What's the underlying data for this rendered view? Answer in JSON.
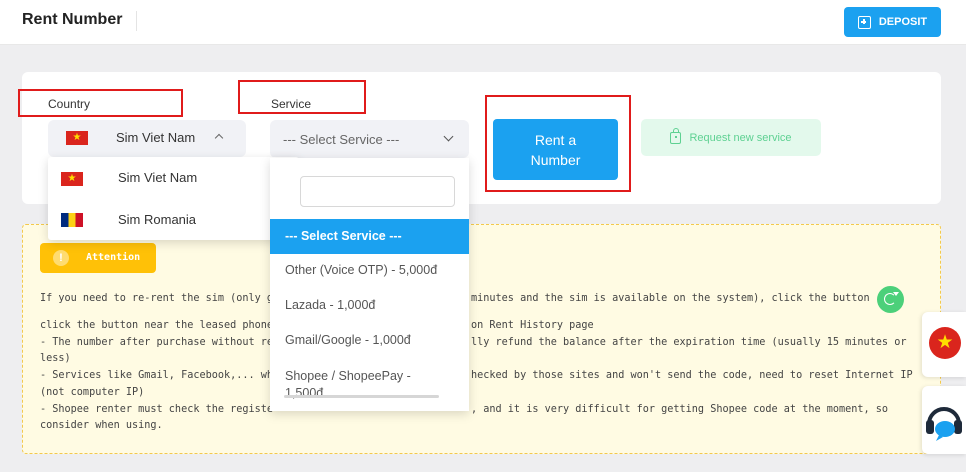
{
  "header": {
    "title": "Rent Number",
    "deposit_label": "DEPOSIT"
  },
  "form": {
    "country_label": "Country",
    "service_label": "Service",
    "country_selected": "Sim Viet Nam",
    "service_selected": "--- Select Service ---",
    "rent_button": "Rent a Number",
    "request_button": "Request new service"
  },
  "country_dropdown": {
    "options": [
      {
        "label": "Sim Viet Nam",
        "flag": "vietnam-flag-icon"
      },
      {
        "label": "Sim Romania",
        "flag": "romania-flag-icon"
      }
    ]
  },
  "service_dropdown": {
    "search_value": "",
    "options": [
      "--- Select Service ---",
      "Other (Voice OTP) - 5,000đ",
      "Lazada - 1,000đ",
      "Gmail/Google - 1,000đ",
      "Shopee / ShopeePay - 1,500đ"
    ]
  },
  "attention": {
    "badge": "Attention",
    "line1_left": "If you need to re-rent the sim (only g",
    "line1_right": "minutes and the sim is available on the system), click the button",
    "line2_left": "click the button near the leased phone",
    "line2_right": "on Rent History page",
    "line3_left": "- The number after purchase without re",
    "line3_right": "lly refund the balance after the expiration time (usually 15 minutes or",
    "line4": "less)",
    "line5_left": "- Services like Gmail, Facebook,... wh",
    "line5_right": "hecked by those sites and won't send the code, need to reset Internet IP",
    "line6": "(not computer IP)",
    "line7_left": "- Shopee renter must check the registe",
    "line7_right": ", and it is very difficult for getting Shopee code at the moment, so",
    "line8": "consider when using."
  },
  "colors": {
    "primary": "#1ba1f0",
    "red_highlight": "#e01b1b",
    "attention_bg": "#fffbe3",
    "attention_badge": "#ffc107",
    "success": "#4cd07a"
  },
  "side_buttons": [
    "vietnam-flag-icon",
    "support-headset-icon"
  ]
}
